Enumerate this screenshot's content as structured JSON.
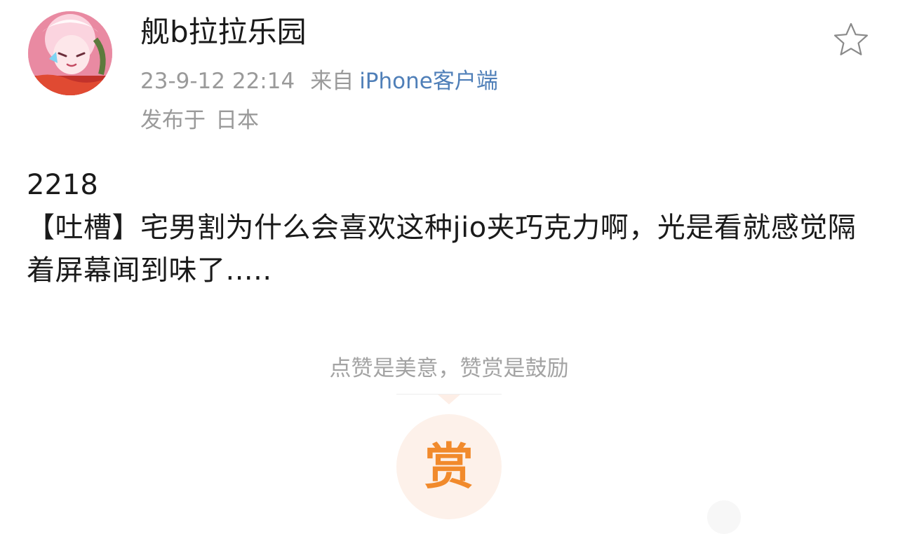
{
  "post": {
    "author": {
      "name": "舰b拉拉乐园",
      "avatar_icon": "avatar-image"
    },
    "timestamp": "23-9-12 22:14",
    "source_prefix": "来自",
    "source_client": "iPhone客户端",
    "location_prefix": "发布于",
    "location": "日本",
    "favorite_icon": "star-outline-icon",
    "id_line": "2218",
    "text": "【吐槽】宅男割为什么会喜欢这种jio夹巧克力啊，光是看就感觉隔着屏幕闻到味了....."
  },
  "reward": {
    "hint": "点赞是美意，赞赏是鼓励",
    "button_label": "赏",
    "accent_color": "#f18a2c",
    "bg_color": "#fdf1ea"
  },
  "colors": {
    "meta_text": "#9a9a9a",
    "client_link": "#4f7fb8",
    "body_text": "#1a1a1a"
  }
}
